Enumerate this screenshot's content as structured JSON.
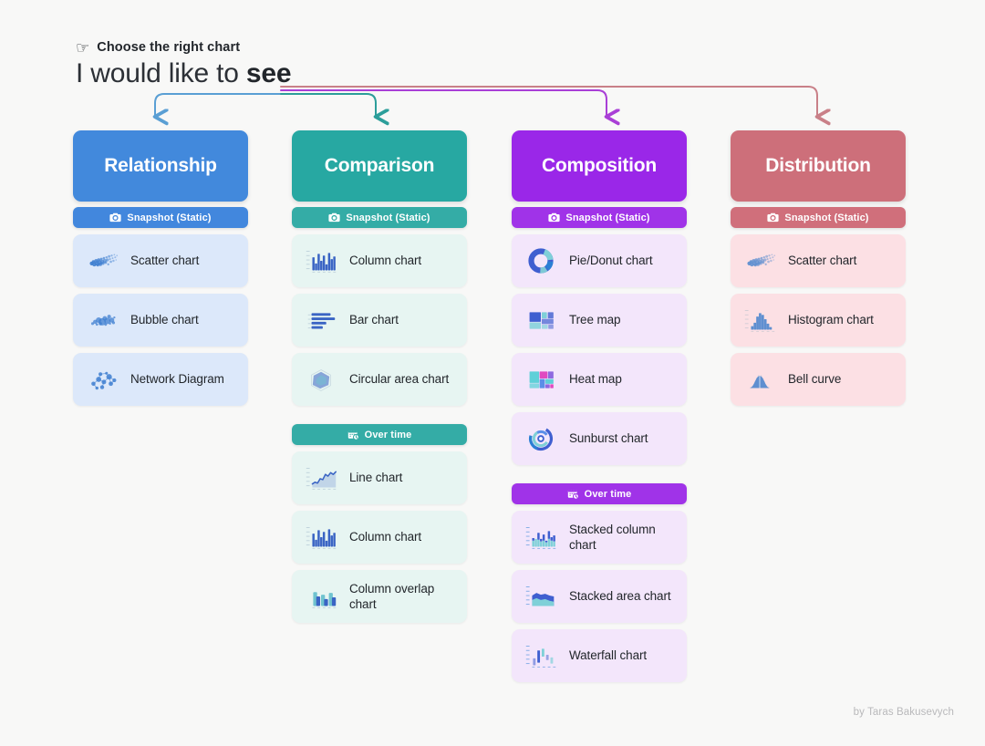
{
  "header": {
    "kicker_icon": "pointing-hand-icon",
    "kicker": "Choose the right chart",
    "headline_plain": "I would like to ",
    "headline_bold": "see"
  },
  "credit": "by Taras Bakusevych",
  "palette": {
    "background": "#f8f8f7",
    "relationship_header": "#4289dc",
    "relationship_badge": "#4287dd",
    "relationship_card": "#dce8fa",
    "relationship_arrow": "#5a9fd4",
    "comparison_header": "#27a8a2",
    "comparison_badge": "#34aca6",
    "comparison_card": "#e7f5f2",
    "comparison_arrow": "#2c9e9a",
    "composition_header": "#9a27e8",
    "composition_badge": "#a033e8",
    "composition_card": "#f3e6fb",
    "composition_arrow": "#a93fd6",
    "distribution_header": "#cd6f7a",
    "distribution_badge": "#d06f7b",
    "distribution_card": "#fce0e4",
    "distribution_arrow": "#c98088",
    "text_dark": "#22262b",
    "credit_gray": "#b9b9bb"
  },
  "columns": [
    {
      "id": "relationship",
      "title": "Relationship",
      "header_color": "#4289dc",
      "badge_color": "#4287dd",
      "card_color": "#dce8fa",
      "groups": [
        {
          "badge": "Snapshot (Static)",
          "badge_icon": "camera-icon",
          "items": [
            {
              "label": "Scatter chart",
              "icon": "scatter-chart-icon"
            },
            {
              "label": "Bubble chart",
              "icon": "bubble-chart-icon"
            },
            {
              "label": "Network Diagram",
              "icon": "network-diagram-icon"
            }
          ]
        }
      ]
    },
    {
      "id": "comparison",
      "title": "Comparison",
      "header_color": "#27a8a2",
      "badge_color": "#34aca6",
      "card_color": "#e7f5f2",
      "groups": [
        {
          "badge": "Snapshot (Static)",
          "badge_icon": "camera-icon",
          "items": [
            {
              "label": "Column chart",
              "icon": "column-chart-icon"
            },
            {
              "label": "Bar chart",
              "icon": "bar-chart-icon"
            },
            {
              "label": "Circular area chart",
              "icon": "circular-area-chart-icon"
            }
          ]
        },
        {
          "badge": "Over time",
          "badge_icon": "calendar-clock-icon",
          "items": [
            {
              "label": "Line chart",
              "icon": "line-chart-icon"
            },
            {
              "label": "Column chart",
              "icon": "column-chart-icon"
            },
            {
              "label": "Column overlap chart",
              "icon": "column-overlap-chart-icon"
            }
          ]
        }
      ]
    },
    {
      "id": "composition",
      "title": "Composition",
      "header_color": "#9a27e8",
      "badge_color": "#a033e8",
      "card_color": "#f3e6fb",
      "groups": [
        {
          "badge": "Snapshot (Static)",
          "badge_icon": "camera-icon",
          "items": [
            {
              "label": "Pie/Donut chart",
              "icon": "donut-chart-icon"
            },
            {
              "label": "Tree map",
              "icon": "tree-map-icon"
            },
            {
              "label": "Heat map",
              "icon": "heat-map-icon"
            },
            {
              "label": "Sunburst chart",
              "icon": "sunburst-chart-icon"
            }
          ]
        },
        {
          "badge": "Over time",
          "badge_icon": "calendar-clock-icon",
          "items": [
            {
              "label": "Stacked column chart",
              "icon": "stacked-column-chart-icon"
            },
            {
              "label": "Stacked area chart",
              "icon": "stacked-area-chart-icon"
            },
            {
              "label": "Waterfall chart",
              "icon": "waterfall-chart-icon"
            }
          ]
        }
      ]
    },
    {
      "id": "distribution",
      "title": "Distribution",
      "header_color": "#cd6f7a",
      "badge_color": "#d06f7b",
      "card_color": "#fce0e4",
      "groups": [
        {
          "badge": "Snapshot (Static)",
          "badge_icon": "camera-icon",
          "items": [
            {
              "label": "Scatter chart",
              "icon": "scatter-chart-icon"
            },
            {
              "label": "Histogram chart",
              "icon": "histogram-chart-icon"
            },
            {
              "label": "Bell curve",
              "icon": "bell-curve-icon"
            }
          ]
        }
      ]
    }
  ]
}
